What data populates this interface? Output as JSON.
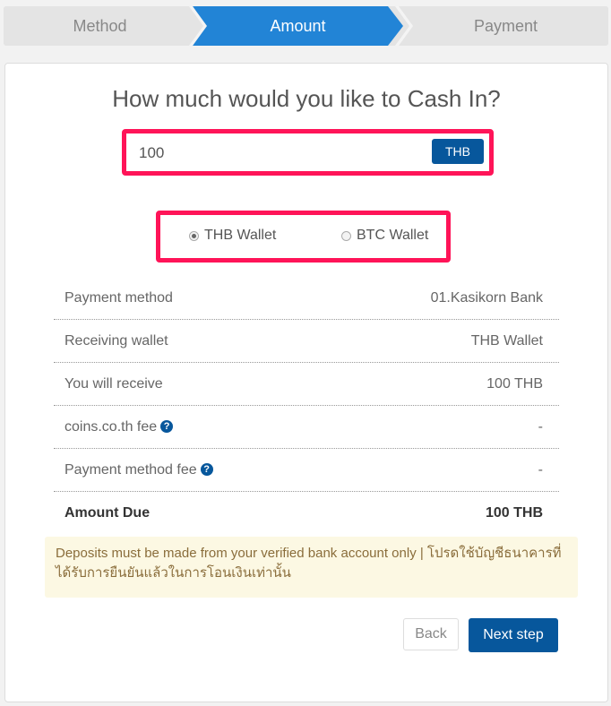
{
  "stepper": {
    "steps": [
      {
        "label": "Method",
        "state": "done"
      },
      {
        "label": "Amount",
        "state": "active"
      },
      {
        "label": "Payment",
        "state": "pending"
      }
    ],
    "active_color": "#2284d6"
  },
  "form": {
    "title": "How much would you like to Cash In?",
    "amount_value": "100",
    "currency_label": "THB",
    "wallet_options": [
      {
        "label": "THB Wallet",
        "selected": true
      },
      {
        "label": "BTC Wallet",
        "selected": false
      }
    ],
    "highlight_color": "#ff1458"
  },
  "summary": {
    "rows": [
      {
        "label": "Payment method",
        "value": "01.Kasikorn Bank"
      },
      {
        "label": "Receiving wallet",
        "value": "THB Wallet"
      },
      {
        "label": "You will receive",
        "value": "100 THB"
      },
      {
        "label": "coins.co.th fee",
        "value": "-",
        "help_icon": "question-circle-icon"
      },
      {
        "label": "Payment method fee",
        "value": "-",
        "help_icon": "question-circle-icon"
      },
      {
        "label": "Amount Due",
        "value": "100 THB"
      }
    ]
  },
  "notice": {
    "text": "Deposits must be made from your verified bank account only | โปรดใช้บัญชีธนาคารที่ได้รับการยืนยันแล้วในการโอนเงินเท่านั้น"
  },
  "actions": {
    "back_label": "Back",
    "next_label": "Next step",
    "primary_color": "#07579c"
  }
}
